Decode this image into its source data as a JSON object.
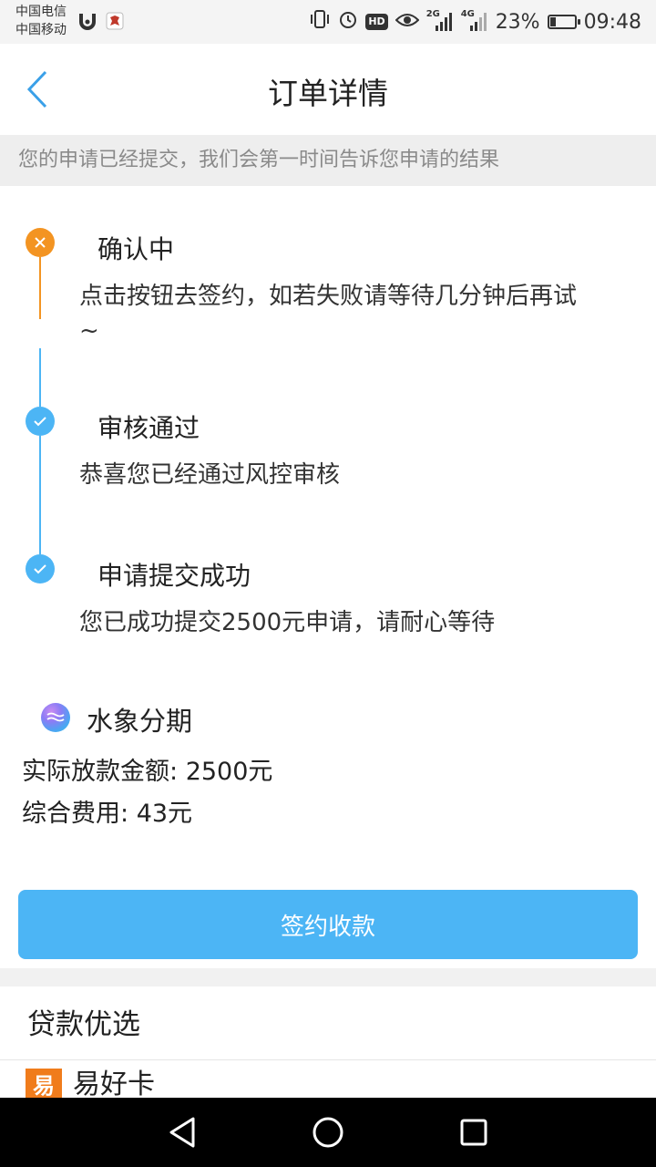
{
  "status_bar": {
    "carrier_1": "中国电信",
    "carrier_2": "中国移动",
    "network_2g": "2G",
    "network_4g": "4G",
    "hd": "HD",
    "battery": "23%",
    "time": "09:48"
  },
  "header": {
    "title": "订单详情"
  },
  "notice": "您的申请已经提交，我们会第一时间告诉您申请的结果",
  "timeline": [
    {
      "title": "确认中",
      "desc_line1": "点击按钮去签约，如若失败请等待几分钟后再试",
      "desc_line2": "~",
      "status": "pending",
      "color": "#f39422"
    },
    {
      "title": "审核通过",
      "desc_line1": "恭喜您已经通过风控审核",
      "status": "done",
      "color": "#4cb5f5"
    },
    {
      "title": "申请提交成功",
      "desc_line1": "您已成功提交2500元申请，请耐心等待",
      "status": "done",
      "color": "#4cb5f5"
    }
  ],
  "product": {
    "name": "水象分期",
    "amount_label": "实际放款金额:",
    "amount_value": "2500元",
    "fee_label": "综合费用:",
    "fee_value": "43元"
  },
  "actions": {
    "sign_label": "签约收款"
  },
  "loan_section": {
    "title": "贷款优选",
    "items": [
      {
        "logo_char": "易",
        "name": "易好卡"
      }
    ]
  },
  "colors": {
    "accent": "#4cb5f5",
    "pending": "#f39422"
  }
}
